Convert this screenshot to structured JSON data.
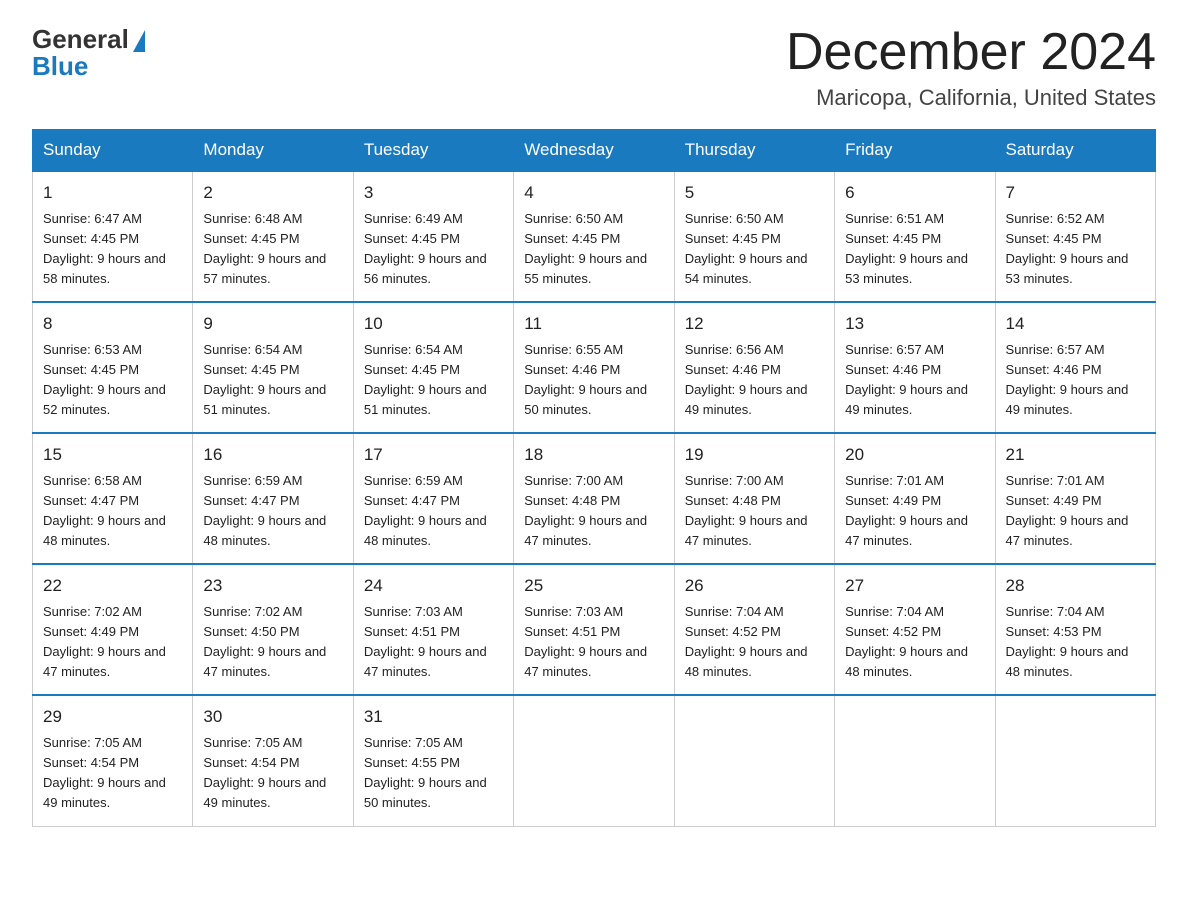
{
  "logo": {
    "general": "General",
    "blue": "Blue"
  },
  "title": "December 2024",
  "location": "Maricopa, California, United States",
  "weekdays": [
    "Sunday",
    "Monday",
    "Tuesday",
    "Wednesday",
    "Thursday",
    "Friday",
    "Saturday"
  ],
  "weeks": [
    [
      {
        "day": "1",
        "sunrise": "6:47 AM",
        "sunset": "4:45 PM",
        "daylight": "9 hours and 58 minutes."
      },
      {
        "day": "2",
        "sunrise": "6:48 AM",
        "sunset": "4:45 PM",
        "daylight": "9 hours and 57 minutes."
      },
      {
        "day": "3",
        "sunrise": "6:49 AM",
        "sunset": "4:45 PM",
        "daylight": "9 hours and 56 minutes."
      },
      {
        "day": "4",
        "sunrise": "6:50 AM",
        "sunset": "4:45 PM",
        "daylight": "9 hours and 55 minutes."
      },
      {
        "day": "5",
        "sunrise": "6:50 AM",
        "sunset": "4:45 PM",
        "daylight": "9 hours and 54 minutes."
      },
      {
        "day": "6",
        "sunrise": "6:51 AM",
        "sunset": "4:45 PM",
        "daylight": "9 hours and 53 minutes."
      },
      {
        "day": "7",
        "sunrise": "6:52 AM",
        "sunset": "4:45 PM",
        "daylight": "9 hours and 53 minutes."
      }
    ],
    [
      {
        "day": "8",
        "sunrise": "6:53 AM",
        "sunset": "4:45 PM",
        "daylight": "9 hours and 52 minutes."
      },
      {
        "day": "9",
        "sunrise": "6:54 AM",
        "sunset": "4:45 PM",
        "daylight": "9 hours and 51 minutes."
      },
      {
        "day": "10",
        "sunrise": "6:54 AM",
        "sunset": "4:45 PM",
        "daylight": "9 hours and 51 minutes."
      },
      {
        "day": "11",
        "sunrise": "6:55 AM",
        "sunset": "4:46 PM",
        "daylight": "9 hours and 50 minutes."
      },
      {
        "day": "12",
        "sunrise": "6:56 AM",
        "sunset": "4:46 PM",
        "daylight": "9 hours and 49 minutes."
      },
      {
        "day": "13",
        "sunrise": "6:57 AM",
        "sunset": "4:46 PM",
        "daylight": "9 hours and 49 minutes."
      },
      {
        "day": "14",
        "sunrise": "6:57 AM",
        "sunset": "4:46 PM",
        "daylight": "9 hours and 49 minutes."
      }
    ],
    [
      {
        "day": "15",
        "sunrise": "6:58 AM",
        "sunset": "4:47 PM",
        "daylight": "9 hours and 48 minutes."
      },
      {
        "day": "16",
        "sunrise": "6:59 AM",
        "sunset": "4:47 PM",
        "daylight": "9 hours and 48 minutes."
      },
      {
        "day": "17",
        "sunrise": "6:59 AM",
        "sunset": "4:47 PM",
        "daylight": "9 hours and 48 minutes."
      },
      {
        "day": "18",
        "sunrise": "7:00 AM",
        "sunset": "4:48 PM",
        "daylight": "9 hours and 47 minutes."
      },
      {
        "day": "19",
        "sunrise": "7:00 AM",
        "sunset": "4:48 PM",
        "daylight": "9 hours and 47 minutes."
      },
      {
        "day": "20",
        "sunrise": "7:01 AM",
        "sunset": "4:49 PM",
        "daylight": "9 hours and 47 minutes."
      },
      {
        "day": "21",
        "sunrise": "7:01 AM",
        "sunset": "4:49 PM",
        "daylight": "9 hours and 47 minutes."
      }
    ],
    [
      {
        "day": "22",
        "sunrise": "7:02 AM",
        "sunset": "4:49 PM",
        "daylight": "9 hours and 47 minutes."
      },
      {
        "day": "23",
        "sunrise": "7:02 AM",
        "sunset": "4:50 PM",
        "daylight": "9 hours and 47 minutes."
      },
      {
        "day": "24",
        "sunrise": "7:03 AM",
        "sunset": "4:51 PM",
        "daylight": "9 hours and 47 minutes."
      },
      {
        "day": "25",
        "sunrise": "7:03 AM",
        "sunset": "4:51 PM",
        "daylight": "9 hours and 47 minutes."
      },
      {
        "day": "26",
        "sunrise": "7:04 AM",
        "sunset": "4:52 PM",
        "daylight": "9 hours and 48 minutes."
      },
      {
        "day": "27",
        "sunrise": "7:04 AM",
        "sunset": "4:52 PM",
        "daylight": "9 hours and 48 minutes."
      },
      {
        "day": "28",
        "sunrise": "7:04 AM",
        "sunset": "4:53 PM",
        "daylight": "9 hours and 48 minutes."
      }
    ],
    [
      {
        "day": "29",
        "sunrise": "7:05 AM",
        "sunset": "4:54 PM",
        "daylight": "9 hours and 49 minutes."
      },
      {
        "day": "30",
        "sunrise": "7:05 AM",
        "sunset": "4:54 PM",
        "daylight": "9 hours and 49 minutes."
      },
      {
        "day": "31",
        "sunrise": "7:05 AM",
        "sunset": "4:55 PM",
        "daylight": "9 hours and 50 minutes."
      },
      null,
      null,
      null,
      null
    ]
  ]
}
